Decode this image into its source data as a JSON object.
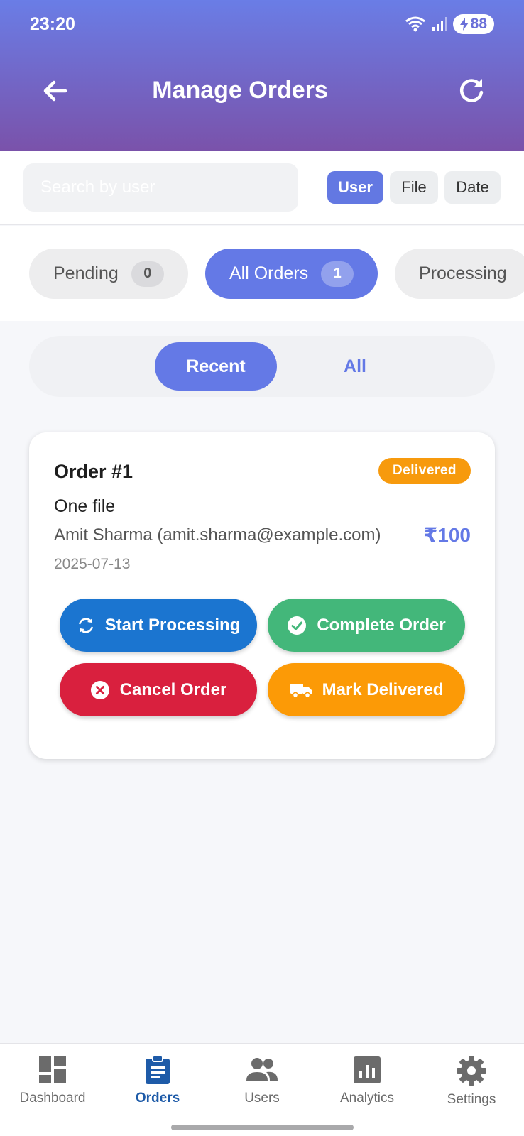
{
  "status_bar": {
    "time": "23:20",
    "battery": "88"
  },
  "header": {
    "title": "Manage Orders",
    "back_icon": "arrow-left-icon",
    "refresh_icon": "refresh-icon"
  },
  "search": {
    "placeholder": "Search by user",
    "value": ""
  },
  "filter_buttons": [
    {
      "label": "User",
      "active": true
    },
    {
      "label": "File",
      "active": false
    },
    {
      "label": "Date",
      "active": false
    }
  ],
  "status_chips": [
    {
      "label": "Pending",
      "count": "0",
      "active": false
    },
    {
      "label": "All Orders",
      "count": "1",
      "active": true
    },
    {
      "label": "Processing",
      "count": "",
      "active": false
    }
  ],
  "view_toggle": {
    "recent": "Recent",
    "all": "All",
    "selected": "Recent"
  },
  "order": {
    "title": "Order #1",
    "status": "Delivered",
    "description": "One file",
    "user": "Amit Sharma (amit.sharma@example.com)",
    "price": "₹100",
    "date": "2025-07-13",
    "actions": {
      "start": "Start Processing",
      "complete": "Complete Order",
      "cancel": "Cancel Order",
      "deliver": "Mark Delivered"
    }
  },
  "colors": {
    "accent": "#6479e6",
    "start": "#1b75d0",
    "complete": "#43b77a",
    "cancel": "#d9203e",
    "deliver": "#fc9a06",
    "nav_active": "#1e5ba8"
  },
  "bottom_nav": {
    "dashboard": "Dashboard",
    "orders": "Orders",
    "users": "Users",
    "analytics": "Analytics",
    "settings": "Settings",
    "active": "Orders"
  }
}
